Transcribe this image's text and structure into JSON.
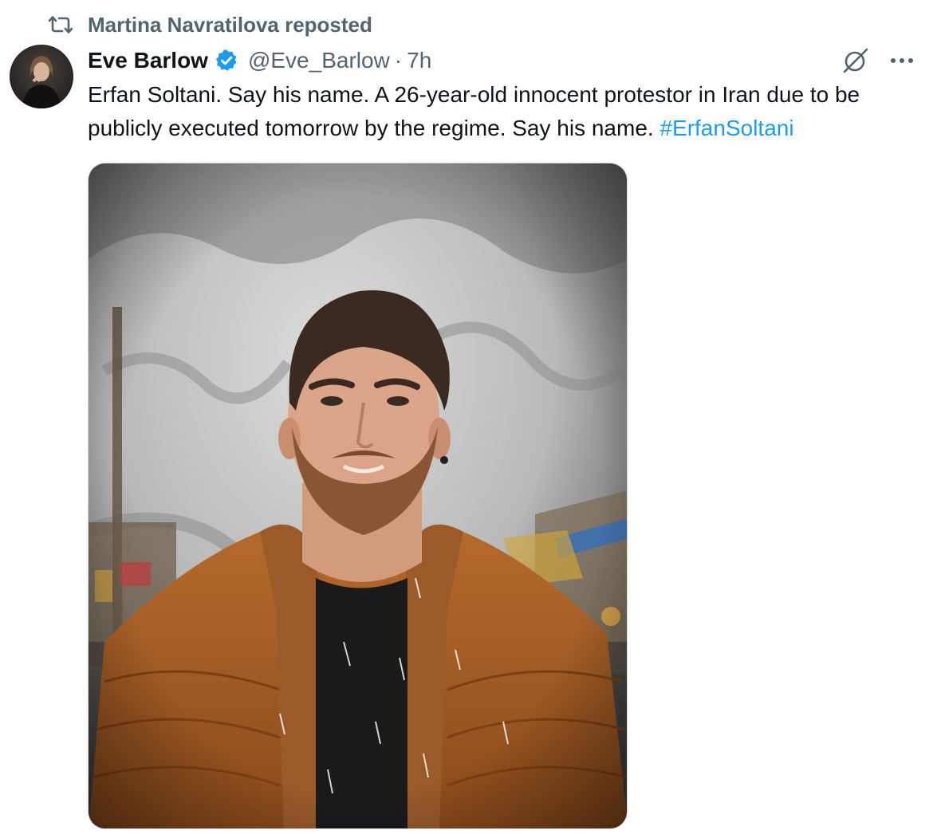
{
  "repost": {
    "text": "Martina Navratilova reposted",
    "icon": "repost-icon"
  },
  "author": {
    "name": "Eve Barlow",
    "handle": "@Eve_Barlow",
    "separator": "·",
    "time": "7h",
    "verified": true,
    "badge_color": "#1d9bf0"
  },
  "actions": {
    "grok_icon": "grok-icon",
    "more_icon": "more-icon"
  },
  "tweet": {
    "text": "Erfan Soltani. Say his name. A 26-year-old innocent protestor in Iran due to be publicly executed tomorrow by the regime. Say his name.",
    "hashtag": "#ErfanSoltani"
  },
  "colors": {
    "secondary_text": "#536471",
    "link": "#1d9bf0"
  }
}
